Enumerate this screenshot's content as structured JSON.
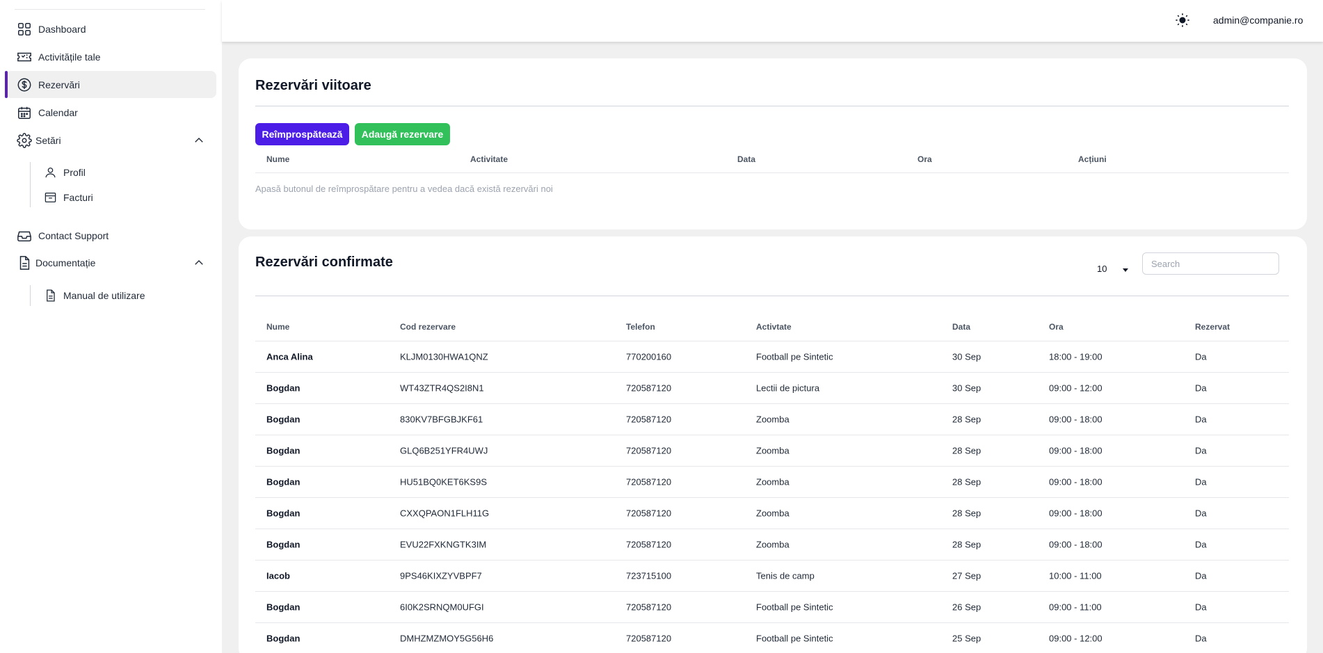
{
  "sidebar": {
    "items": [
      {
        "label": "Dashboard",
        "icon": "grid-icon"
      },
      {
        "label": "Activitățile tale",
        "icon": "ticket-icon"
      },
      {
        "label": "Rezervări",
        "icon": "dollar-circle-icon"
      },
      {
        "label": "Calendar",
        "icon": "calendar-icon"
      },
      {
        "label": "Setări",
        "icon": "gear-icon"
      },
      {
        "label": "Contact Support",
        "icon": "inbox-icon"
      },
      {
        "label": "Documentație",
        "icon": "document-icon"
      }
    ],
    "settings_sub": [
      {
        "label": "Profil",
        "icon": "user-icon"
      },
      {
        "label": "Facturi",
        "icon": "archive-icon"
      }
    ],
    "docs_sub": [
      {
        "label": "Manual de utilizare",
        "icon": "document-icon"
      }
    ],
    "active_index": 2,
    "accent_color": "#5b21b6"
  },
  "header": {
    "theme_icon": "sun-icon",
    "user_email": "admin@companie.ro"
  },
  "upcoming": {
    "title": "Rezervări viitoare",
    "refresh_label": "Reîmprospătează",
    "add_label": "Adaugă rezervare",
    "refresh_color": "#4c1de6",
    "add_color": "#31c05a",
    "columns": [
      "Nume",
      "Activitate",
      "Data",
      "Ora",
      "Acțiuni"
    ],
    "empty_message": "Apasă butonul de reîmprospătare pentru a vedea dacă există rezervări noi"
  },
  "confirmed": {
    "title": "Rezervări confirmate",
    "page_size": "10",
    "search_placeholder": "Search",
    "columns": [
      "Nume",
      "Cod rezervare",
      "Telefon",
      "Activtate",
      "Data",
      "Ora",
      "Rezervat"
    ],
    "rows": [
      [
        "Anca Alina",
        "KLJM0130HWA1QNZ",
        "770200160",
        "Football pe Sintetic",
        "30 Sep",
        "18:00 - 19:00",
        "Da"
      ],
      [
        "Bogdan",
        "WT43ZTR4QS2I8N1",
        "720587120",
        "Lectii de pictura",
        "30 Sep",
        "09:00 - 12:00",
        "Da"
      ],
      [
        "Bogdan",
        "830KV7BFGBJKF61",
        "720587120",
        "Zoomba",
        "28 Sep",
        "09:00 - 18:00",
        "Da"
      ],
      [
        "Bogdan",
        "GLQ6B251YFR4UWJ",
        "720587120",
        "Zoomba",
        "28 Sep",
        "09:00 - 18:00",
        "Da"
      ],
      [
        "Bogdan",
        "HU51BQ0KET6KS9S",
        "720587120",
        "Zoomba",
        "28 Sep",
        "09:00 - 18:00",
        "Da"
      ],
      [
        "Bogdan",
        "CXXQPAON1FLH11G",
        "720587120",
        "Zoomba",
        "28 Sep",
        "09:00 - 18:00",
        "Da"
      ],
      [
        "Bogdan",
        "EVU22FXKNGTK3IM",
        "720587120",
        "Zoomba",
        "28 Sep",
        "09:00 - 18:00",
        "Da"
      ],
      [
        "Iacob",
        "9PS46KIXZYVBPF7",
        "723715100",
        "Tenis de camp",
        "27 Sep",
        "10:00 - 11:00",
        "Da"
      ],
      [
        "Bogdan",
        "6I0K2SRNQM0UFGI",
        "720587120",
        "Football pe Sintetic",
        "26 Sep",
        "09:00 - 11:00",
        "Da"
      ],
      [
        "Bogdan",
        "DMHZMZMOY5G56H6",
        "720587120",
        "Football pe Sintetic",
        "25 Sep",
        "09:00 - 12:00",
        "Da"
      ]
    ]
  }
}
